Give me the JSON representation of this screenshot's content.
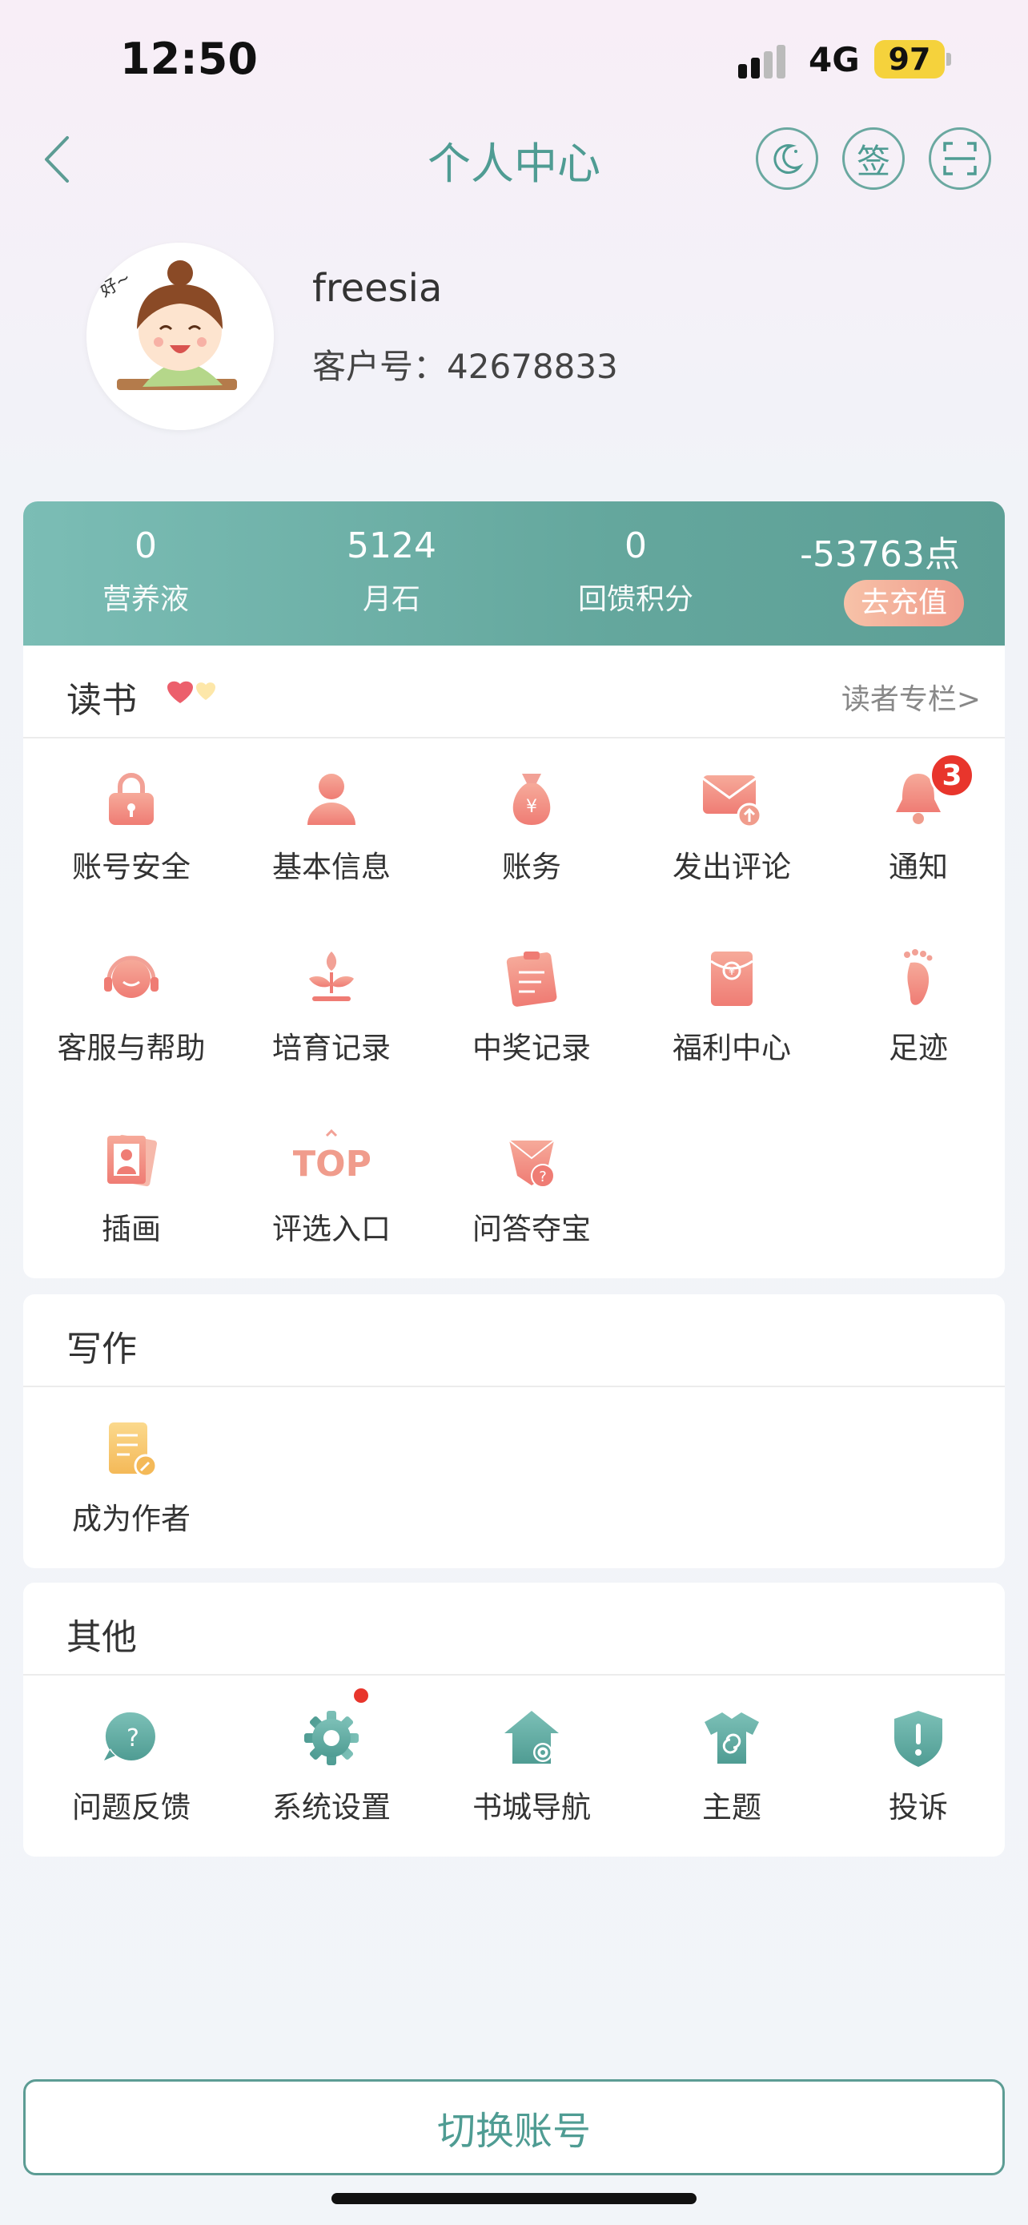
{
  "status": {
    "time": "12:50",
    "network": "4G",
    "battery": "97"
  },
  "nav": {
    "title": "个人中心",
    "sign_label": "签"
  },
  "profile": {
    "username": "freesia",
    "customer_label": "客户号：42678833",
    "avatar_text": "好~"
  },
  "stats": [
    {
      "value": "0",
      "label": "营养液"
    },
    {
      "value": "5124",
      "label": "月石"
    },
    {
      "value": "0",
      "label": "回馈积分"
    }
  ],
  "points": {
    "value": "-53763点",
    "recharge_label": "去充值"
  },
  "reading": {
    "title": "读书",
    "column_link": "读者专栏>",
    "items": [
      {
        "label": "账号安全",
        "icon": "lock-icon"
      },
      {
        "label": "基本信息",
        "icon": "user-icon"
      },
      {
        "label": "账务",
        "icon": "money-bag-icon"
      },
      {
        "label": "发出评论",
        "icon": "envelope-icon"
      },
      {
        "label": "通知",
        "icon": "bell-icon",
        "badge": "3"
      },
      {
        "label": "客服与帮助",
        "icon": "headset-icon"
      },
      {
        "label": "培育记录",
        "icon": "sprout-icon"
      },
      {
        "label": "中奖记录",
        "icon": "clipboard-icon"
      },
      {
        "label": "福利中心",
        "icon": "red-packet-icon"
      },
      {
        "label": "足迹",
        "icon": "footprint-icon"
      },
      {
        "label": "插画",
        "icon": "picture-icon"
      },
      {
        "label": "评选入口",
        "icon": "top-icon",
        "icon_text": "TOP"
      },
      {
        "label": "问答夺宝",
        "icon": "gem-question-icon"
      }
    ]
  },
  "writing": {
    "title": "写作",
    "items": [
      {
        "label": "成为作者",
        "icon": "document-pen-icon"
      }
    ]
  },
  "other": {
    "title": "其他",
    "items": [
      {
        "label": "问题反馈",
        "icon": "question-bubble-icon"
      },
      {
        "label": "系统设置",
        "icon": "gear-icon"
      },
      {
        "label": "书城导航",
        "icon": "home-gear-icon"
      },
      {
        "label": "主题",
        "icon": "shirt-icon"
      },
      {
        "label": "投诉",
        "icon": "shield-alert-icon"
      }
    ]
  },
  "footer": {
    "switch_account_label": "切换账号"
  },
  "colors": {
    "accent": "#4f9c93",
    "stats_bg": "#64a79d",
    "icon_pink": "#f0877c",
    "icon_teal": "#5aa59c",
    "badge": "#e8352c"
  }
}
